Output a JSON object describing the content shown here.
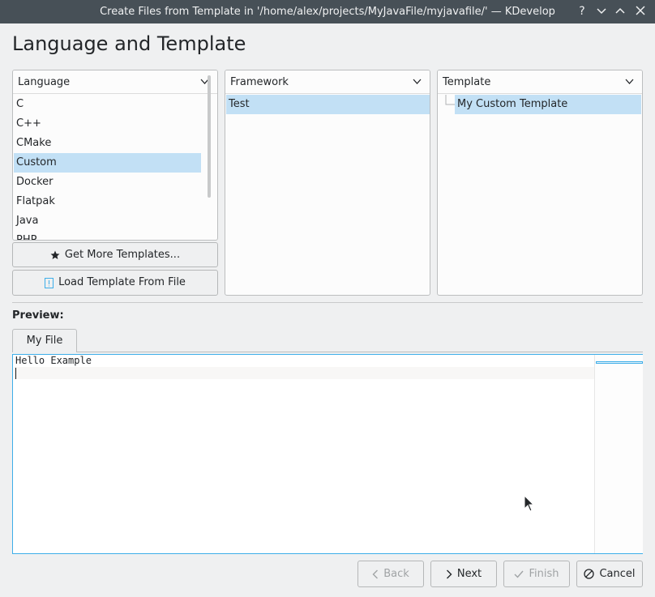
{
  "window": {
    "title": "Create Files from Template in '/home/alex/projects/MyJavaFile/myjavafile/' — KDevelop",
    "help_glyph": "?"
  },
  "page": {
    "title": "Language and Template"
  },
  "language_panel": {
    "header": "Language",
    "items": [
      "C",
      "C++",
      "CMake",
      "Custom",
      "Docker",
      "Flatpak",
      "Java",
      "PHP"
    ],
    "selected": "Custom"
  },
  "framework_panel": {
    "header": "Framework",
    "items": [
      "Test"
    ],
    "selected": "Test"
  },
  "template_panel": {
    "header": "Template",
    "items": [
      "My Custom Template"
    ],
    "selected": "My Custom Template"
  },
  "buttons": {
    "get_more": "Get More Templates...",
    "load_from_file": "Load Template From File",
    "back": "Back",
    "next": "Next",
    "finish": "Finish",
    "cancel": "Cancel"
  },
  "preview": {
    "label": "Preview:",
    "tab": "My File",
    "content_line1": "Hello Example"
  },
  "colors": {
    "titlebar": "#475057",
    "selection": "#c2e0f5",
    "focus": "#3daee9",
    "window_bg": "#eff0f1"
  },
  "icons": {
    "star": "star-icon",
    "file": "file-icon",
    "back": "chevron-left-icon",
    "next": "chevron-right-icon",
    "finish": "check-icon",
    "cancel": "cancel-icon"
  }
}
